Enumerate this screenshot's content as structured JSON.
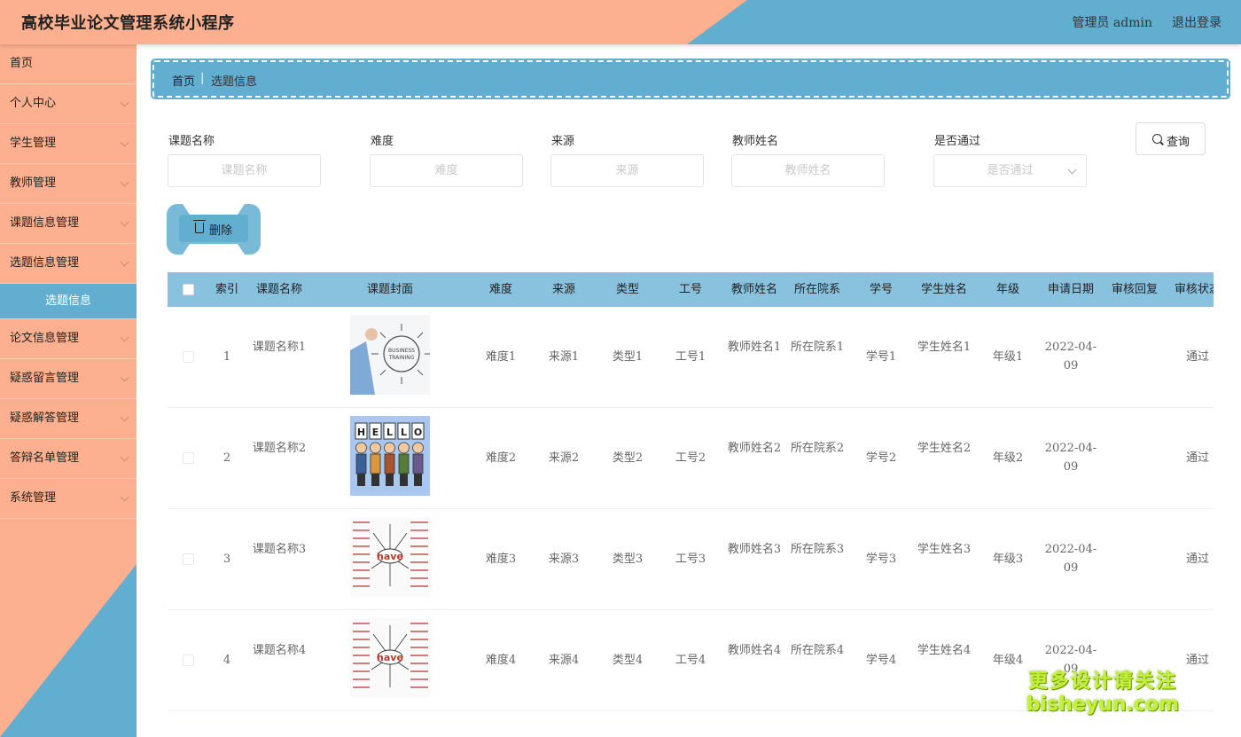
{
  "header": {
    "title": "高校毕业论文管理系统小程序",
    "user": "管理员 admin",
    "logout": "退出登录"
  },
  "sidebar": {
    "items": [
      {
        "label": "首页",
        "has_arrow": false
      },
      {
        "label": "个人中心",
        "has_arrow": true
      },
      {
        "label": "学生管理",
        "has_arrow": true
      },
      {
        "label": "教师管理",
        "has_arrow": true
      },
      {
        "label": "课题信息管理",
        "has_arrow": true
      },
      {
        "label": "选题信息管理",
        "has_arrow": true
      }
    ],
    "active_sub": "选题信息",
    "items_after": [
      {
        "label": "论文信息管理",
        "has_arrow": true
      },
      {
        "label": "疑惑留言管理",
        "has_arrow": true
      },
      {
        "label": "疑惑解答管理",
        "has_arrow": true
      },
      {
        "label": "答辩名单管理",
        "has_arrow": true
      },
      {
        "label": "系统管理",
        "has_arrow": true
      }
    ]
  },
  "breadcrumb": {
    "home": "首页",
    "separator": "|",
    "current": "选题信息"
  },
  "filters": {
    "topic_label": "课题名称",
    "topic_placeholder": "课题名称",
    "difficulty_label": "难度",
    "difficulty_placeholder": "难度",
    "source_label": "来源",
    "source_placeholder": "来源",
    "teacher_label": "教师姓名",
    "teacher_placeholder": "教师姓名",
    "passed_label": "是否通过",
    "passed_placeholder": "是否通过",
    "query_button": "查询"
  },
  "actions": {
    "delete_button": "删除"
  },
  "table": {
    "columns": [
      "索引",
      "课题名称",
      "课题封面",
      "难度",
      "来源",
      "类型",
      "工号",
      "教师姓名",
      "所在院系",
      "学号",
      "学生姓名",
      "年级",
      "申请日期",
      "审核回复",
      "审核状态"
    ],
    "rows": [
      {
        "index": "1",
        "topic": "课题名称1",
        "difficulty": "难度1",
        "source": "来源1",
        "type": "类型1",
        "staff_no": "工号1",
        "teacher": "教师姓名1",
        "dept": "所在院系1",
        "student_no": "学号1",
        "student": "学生姓名1",
        "grade": "年级1",
        "date": "2022-04-09",
        "reply": "",
        "status": "通过",
        "cover": "business-training-image"
      },
      {
        "index": "2",
        "topic": "课题名称2",
        "difficulty": "难度2",
        "source": "来源2",
        "type": "类型2",
        "staff_no": "工号2",
        "teacher": "教师姓名2",
        "dept": "所在院系2",
        "student_no": "学号2",
        "student": "学生姓名2",
        "grade": "年级2",
        "date": "2022-04-09",
        "reply": "",
        "status": "通过",
        "cover": "hello-people-image"
      },
      {
        "index": "3",
        "topic": "课题名称3",
        "difficulty": "难度3",
        "source": "来源3",
        "type": "类型3",
        "staff_no": "工号3",
        "teacher": "教师姓名3",
        "dept": "所在院系3",
        "student_no": "学号3",
        "student": "学生姓名3",
        "grade": "年级3",
        "date": "2022-04-09",
        "reply": "",
        "status": "通过",
        "cover": "have-mindmap-image"
      },
      {
        "index": "4",
        "topic": "课题名称4",
        "difficulty": "难度4",
        "source": "来源4",
        "type": "类型4",
        "staff_no": "工号4",
        "teacher": "教师姓名4",
        "dept": "所在院系4",
        "student_no": "学号4",
        "student": "学生姓名4",
        "grade": "年级4",
        "date": "2022-04-09",
        "reply": "",
        "status": "通过",
        "cover": "have-mindmap-image"
      }
    ]
  },
  "watermark": {
    "line1": "更多设计请关注",
    "line2": "bisheyun.com"
  },
  "colors": {
    "salmon": "#fdb08f",
    "blue": "#61aed1",
    "table_header": "#88c2de"
  }
}
